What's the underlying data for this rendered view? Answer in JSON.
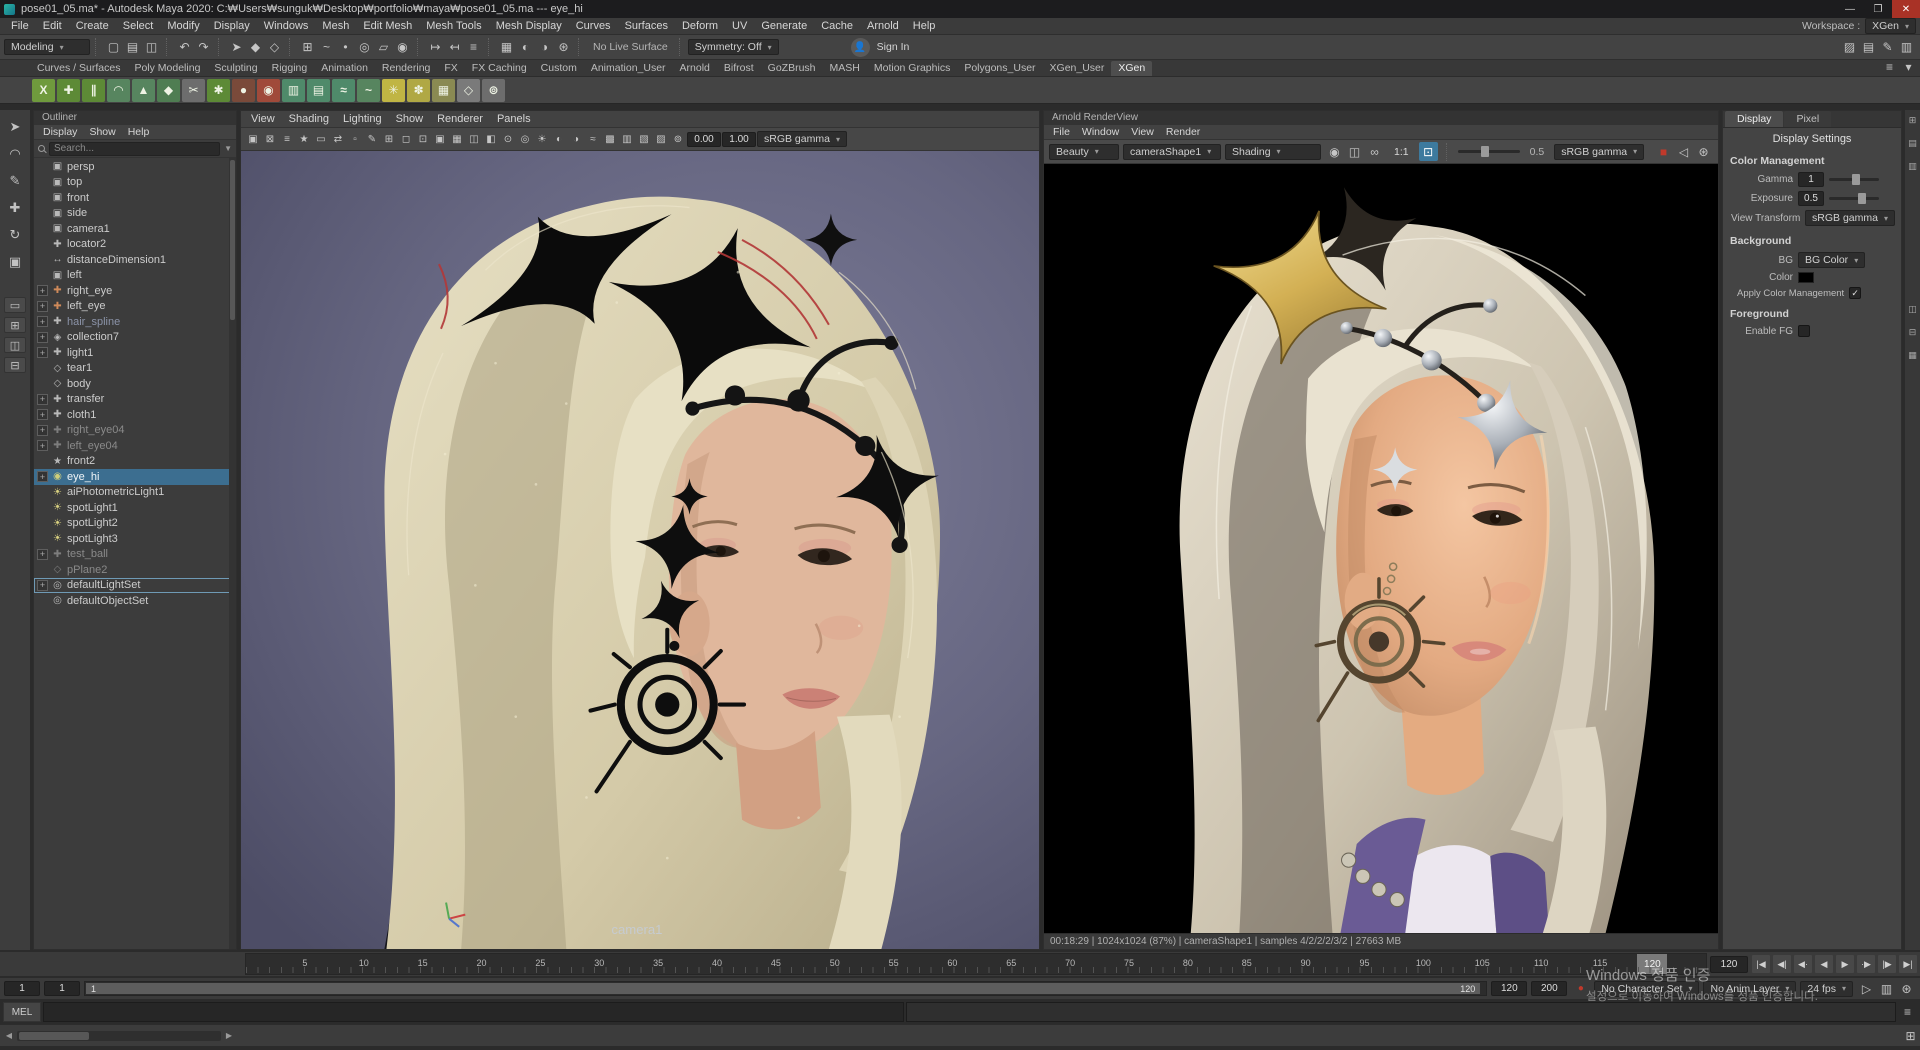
{
  "window": {
    "title": "pose01_05.ma* - Autodesk Maya 2020: C:₩Users₩sunguk₩Desktop₩portfolio₩maya₩pose01_05.ma --- eye_hi",
    "minimize": "—",
    "maximize": "❐",
    "close": "✕"
  },
  "menubar": {
    "items": [
      "File",
      "Edit",
      "Create",
      "Select",
      "Modify",
      "Display",
      "Windows",
      "Mesh",
      "Edit Mesh",
      "Mesh Tools",
      "Mesh Display",
      "Curves",
      "Surfaces",
      "Deform",
      "UV",
      "Generate",
      "Cache",
      "Arnold",
      "Help"
    ],
    "workspace_label": "Workspace :",
    "workspace_value": "XGen"
  },
  "statusline": {
    "mode": "Modeling",
    "no_live_surface": "No Live Surface",
    "symmetry": "Symmetry: Off",
    "sign_in": "Sign In",
    "file_icons": [
      {
        "name": "new-scene-icon",
        "glyph": "▢"
      },
      {
        "name": "open-scene-icon",
        "glyph": "▤"
      },
      {
        "name": "save-scene-icon",
        "glyph": "◫"
      }
    ],
    "undo_icons": [
      {
        "name": "undo-icon",
        "glyph": "↶"
      },
      {
        "name": "redo-icon",
        "glyph": "↷"
      }
    ],
    "select_icons": [
      {
        "name": "select-by-hierarchy-icon",
        "glyph": "➤"
      },
      {
        "name": "select-by-object-icon",
        "glyph": "◆"
      },
      {
        "name": "select-by-component-icon",
        "glyph": "◇"
      }
    ],
    "snap_icons": [
      {
        "name": "snap-to-grid-icon",
        "glyph": "⊞"
      },
      {
        "name": "snap-to-curve-icon",
        "glyph": "~"
      },
      {
        "name": "snap-to-point-icon",
        "glyph": "•"
      },
      {
        "name": "snap-to-projected-center-icon",
        "glyph": "◎"
      },
      {
        "name": "snap-to-view-plane-icon",
        "glyph": "▱"
      },
      {
        "name": "make-live-icon",
        "glyph": "◉"
      }
    ],
    "history_icons": [
      {
        "name": "input-connections-icon",
        "glyph": "↦"
      },
      {
        "name": "output-connections-icon",
        "glyph": "↤"
      },
      {
        "name": "construction-history-icon",
        "glyph": "≡"
      }
    ],
    "render_icons": [
      {
        "name": "render-view-icon",
        "glyph": "▦"
      },
      {
        "name": "current-frame-render-icon",
        "glyph": "◐"
      },
      {
        "name": "ipr-render-icon",
        "glyph": "◑"
      },
      {
        "name": "render-settings-icon",
        "glyph": "⊛"
      }
    ],
    "right_icons": [
      {
        "name": "modeling-toolkit-icon",
        "glyph": "▨"
      },
      {
        "name": "attribute-editor-icon",
        "glyph": "▤"
      },
      {
        "name": "tool-settings-icon",
        "glyph": "✎"
      },
      {
        "name": "channel-box-icon",
        "glyph": "▥"
      }
    ]
  },
  "shelf": {
    "tabs": [
      "Curves / Surfaces",
      "Poly Modeling",
      "Sculpting",
      "Rigging",
      "Animation",
      "Rendering",
      "FX",
      "FX Caching",
      "Custom",
      "Animation_User",
      "Arnold",
      "Bifrost",
      "GoZBrush",
      "MASH",
      "Motion Graphics",
      "Polygons_User",
      "XGen_User",
      "XGen"
    ],
    "active_tab": "XGen",
    "menu_icons": [
      {
        "name": "shelf-menu-icon",
        "glyph": "≡"
      },
      {
        "name": "shelf-options-icon",
        "glyph": "▾"
      }
    ],
    "icons": [
      {
        "name": "xgen-create-description-icon",
        "glyph": "X",
        "bg": "#6f9a3d"
      },
      {
        "name": "xgen-add-guide-icon",
        "glyph": "✚",
        "bg": "#5d8a36"
      },
      {
        "name": "xgen-guides-icon",
        "glyph": "∥",
        "bg": "#5d8a36"
      },
      {
        "name": "xgen-comb-icon",
        "glyph": "◠",
        "bg": "#57855f"
      },
      {
        "name": "xgen-density-icon",
        "glyph": "▲",
        "bg": "#57855f"
      },
      {
        "name": "xgen-clump-icon",
        "glyph": "◆",
        "bg": "#4f7d52"
      },
      {
        "name": "xgen-cut-icon",
        "glyph": "✂",
        "bg": "#6d6d6d"
      },
      {
        "name": "xgen-noise-icon",
        "glyph": "✱",
        "bg": "#5d8a36"
      },
      {
        "name": "xgen-sphere-icon",
        "glyph": "●",
        "bg": "#7a4a3a"
      },
      {
        "name": "xgen-bake-icon",
        "glyph": "◉",
        "bg": "#a04a3a"
      },
      {
        "name": "xgen-patch-icon",
        "glyph": "▥",
        "bg": "#4f8a6a"
      },
      {
        "name": "xgen-collection-icon",
        "glyph": "▤",
        "bg": "#4f8a6a"
      },
      {
        "name": "xgen-modifier-icon",
        "glyph": "≈",
        "bg": "#4f8a6a"
      },
      {
        "name": "xgen-curve-icon",
        "glyph": "~",
        "bg": "#57855f"
      },
      {
        "name": "xgen-preview-icon",
        "glyph": "✳",
        "bg": "#c0b544"
      },
      {
        "name": "xgen-export-icon",
        "glyph": "✽",
        "bg": "#b0a844"
      },
      {
        "name": "xgen-grid-icon",
        "glyph": "▦",
        "bg": "#8a8a52"
      },
      {
        "name": "xgen-freeze-icon",
        "glyph": "◇",
        "bg": "#7a7a7a"
      },
      {
        "name": "xgen-util-icon",
        "glyph": "⊚",
        "bg": "#6d6d6d"
      }
    ]
  },
  "toolbox": {
    "tools": [
      {
        "name": "select-tool-icon",
        "glyph": "➤"
      },
      {
        "name": "lasso-tool-icon",
        "glyph": "◠"
      },
      {
        "name": "paint-select-tool-icon",
        "glyph": "✎"
      },
      {
        "name": "move-tool-icon",
        "glyph": "✚"
      },
      {
        "name": "rotate-tool-icon",
        "glyph": "↻"
      },
      {
        "name": "scale-tool-icon",
        "glyph": "▣"
      }
    ],
    "layouts": [
      {
        "name": "single-pane-layout-icon",
        "glyph": "▭"
      },
      {
        "name": "four-pane-layout-icon",
        "glyph": "⊞"
      },
      {
        "name": "persp-outliner-layout-icon",
        "glyph": "◫"
      },
      {
        "name": "custom-layout-icon",
        "glyph": "⊟"
      }
    ]
  },
  "outliner": {
    "title": "Outliner",
    "menus": [
      "Display",
      "Show",
      "Help"
    ],
    "search_placeholder": "Search...",
    "items": [
      {
        "label": "persp",
        "icon": "camera-icon",
        "glyph": "▣",
        "expand": false,
        "state": "normal"
      },
      {
        "label": "top",
        "icon": "camera-icon",
        "glyph": "▣",
        "expand": false,
        "state": "normal"
      },
      {
        "label": "front",
        "icon": "camera-icon",
        "glyph": "▣",
        "expand": false,
        "state": "normal"
      },
      {
        "label": "side",
        "icon": "camera-icon",
        "glyph": "▣",
        "expand": false,
        "state": "normal"
      },
      {
        "label": "camera1",
        "icon": "camera-icon",
        "glyph": "▣",
        "expand": false,
        "state": "normal"
      },
      {
        "label": "locator2",
        "icon": "locator-icon",
        "glyph": "✚",
        "expand": false,
        "state": "normal"
      },
      {
        "label": "distanceDimension1",
        "icon": "distance-dimension-icon",
        "glyph": "↔",
        "expand": false,
        "state": "normal"
      },
      {
        "label": "left",
        "icon": "camera-icon",
        "glyph": "▣",
        "expand": false,
        "state": "normal"
      },
      {
        "label": "right_eye",
        "icon": "transform-icon",
        "glyph": "✚",
        "color": "#cf8a5a",
        "expand": true,
        "state": "normal"
      },
      {
        "label": "left_eye",
        "icon": "transform-icon",
        "glyph": "✚",
        "color": "#cf8a5a",
        "expand": true,
        "state": "normal"
      },
      {
        "label": "hair_spline",
        "icon": "transform-icon",
        "glyph": "✚",
        "expand": true,
        "state": "ref"
      },
      {
        "label": "collection7",
        "icon": "collection-icon",
        "glyph": "◈",
        "expand": true,
        "state": "normal"
      },
      {
        "label": "light1",
        "icon": "transform-icon",
        "glyph": "✚",
        "expand": true,
        "state": "normal"
      },
      {
        "label": "tear1",
        "icon": "mesh-icon",
        "glyph": "◇",
        "expand": false,
        "state": "normal"
      },
      {
        "label": "body",
        "icon": "mesh-icon",
        "glyph": "◇",
        "expand": false,
        "state": "normal"
      },
      {
        "label": "transfer",
        "icon": "transform-icon",
        "glyph": "✚",
        "expand": true,
        "state": "normal"
      },
      {
        "label": "cloth1",
        "icon": "transform-icon",
        "glyph": "✚",
        "expand": true,
        "state": "normal"
      },
      {
        "label": "right_eye04",
        "icon": "transform-icon",
        "glyph": "✚",
        "expand": true,
        "state": "dim"
      },
      {
        "label": "left_eye04",
        "icon": "transform-icon",
        "glyph": "✚",
        "expand": true,
        "state": "dim"
      },
      {
        "label": "front2",
        "icon": "camera-icon",
        "glyph": "★",
        "expand": false,
        "state": "normal"
      },
      {
        "label": "eye_hi",
        "icon": "textured-sphere-icon",
        "glyph": "◉",
        "color": "#cfcf7a",
        "expand": true,
        "state": "selected"
      },
      {
        "label": "aiPhotometricLight1",
        "icon": "light-icon",
        "glyph": "☀",
        "color": "#d8d080",
        "expand": false,
        "state": "normal"
      },
      {
        "label": "spotLight1",
        "icon": "spotlight-icon",
        "glyph": "☀",
        "color": "#d8d080",
        "expand": false,
        "state": "normal"
      },
      {
        "label": "spotLight2",
        "icon": "spotlight-icon",
        "glyph": "☀",
        "color": "#d8d080",
        "expand": false,
        "state": "normal"
      },
      {
        "label": "spotLight3",
        "icon": "spotlight-icon",
        "glyph": "☀",
        "color": "#d8d080",
        "expand": false,
        "state": "normal"
      },
      {
        "label": "test_ball",
        "icon": "transform-icon",
        "glyph": "✚",
        "expand": true,
        "state": "dim"
      },
      {
        "label": "pPlane2",
        "icon": "mesh-icon",
        "glyph": "◇",
        "expand": false,
        "state": "dim"
      },
      {
        "label": "defaultLightSet",
        "icon": "set-icon",
        "glyph": "◎",
        "expand": true,
        "state": "outlined"
      },
      {
        "label": "defaultObjectSet",
        "icon": "set-icon",
        "glyph": "◎",
        "expand": false,
        "state": "normal"
      }
    ]
  },
  "viewport": {
    "menus": [
      "View",
      "Shading",
      "Lighting",
      "Show",
      "Renderer",
      "Panels"
    ],
    "toolbar": {
      "icons": [
        {
          "name": "select-camera-icon",
          "glyph": "▣"
        },
        {
          "name": "lock-camera-icon",
          "glyph": "⊠"
        },
        {
          "name": "camera-attributes-icon",
          "glyph": "≡"
        },
        {
          "name": "bookmark-icon",
          "glyph": "★"
        },
        {
          "name": "image-plane-icon",
          "glyph": "▭"
        },
        {
          "name": "2d-pan-zoom-icon",
          "glyph": "⇄"
        },
        {
          "name": "oversampling-icon",
          "glyph": "▫"
        },
        {
          "name": "grease-pencil-icon",
          "glyph": "✎"
        },
        {
          "name": "grid-icon",
          "glyph": "⊞"
        },
        {
          "name": "film-gate-icon",
          "glyph": "◻"
        },
        {
          "name": "resolution-gate-icon",
          "glyph": "⊡"
        },
        {
          "name": "gate-mask-icon",
          "glyph": "▣"
        },
        {
          "name": "field-chart-icon",
          "glyph": "▦"
        },
        {
          "name": "safe-action-icon",
          "glyph": "◫"
        },
        {
          "name": "safe-title-icon",
          "glyph": "◧"
        },
        {
          "name": "frame-all-icon",
          "glyph": "⊙"
        },
        {
          "name": "frame-selected-icon",
          "glyph": "◎"
        },
        {
          "name": "lighting-icon",
          "glyph": "☀"
        },
        {
          "name": "shadows-icon",
          "glyph": "◐"
        },
        {
          "name": "ssao-icon",
          "glyph": "◑"
        },
        {
          "name": "motion-blur-icon",
          "glyph": "≈"
        },
        {
          "name": "multisample-icon",
          "glyph": "▩"
        },
        {
          "name": "xray-icon",
          "glyph": "▥"
        },
        {
          "name": "wireframe-on-shaded-icon",
          "glyph": "▧"
        },
        {
          "name": "textured-icon",
          "glyph": "▨"
        },
        {
          "name": "isolate-select-icon",
          "glyph": "⊚"
        }
      ],
      "field1": "0.00",
      "field2": "1.00",
      "gamma": "sRGB gamma"
    },
    "camera_label": "camera1"
  },
  "arnold": {
    "title": "Arnold RenderView",
    "menus": [
      "File",
      "Window",
      "View",
      "Render"
    ],
    "toolbar": {
      "aov": "Beauty",
      "camera": "cameraShape1",
      "shading": "Shading",
      "mid_icons": [
        {
          "name": "snapshot-icon",
          "glyph": "◉"
        },
        {
          "name": "compare-icon",
          "glyph": "◫"
        },
        {
          "name": "sync-camera-icon",
          "glyph": "∞"
        }
      ],
      "zoom": "1:1",
      "exposure_value": "0.5",
      "gamma": "sRGB gamma",
      "right_icons": [
        {
          "name": "stop-render-icon",
          "glyph": "■",
          "color": "#c0392b"
        },
        {
          "name": "mute-icon",
          "glyph": "◁"
        },
        {
          "name": "settings-gear-icon",
          "glyph": "⊛"
        }
      ]
    },
    "status": "00:18:29 | 1024x1024 (87%) | cameraShape1  | samples 4/2/2/2/3/2 | 27663 MB"
  },
  "display_settings": {
    "tabs": [
      "Display",
      "Pixel"
    ],
    "title": "Display Settings",
    "sections": {
      "color_management": {
        "title": "Color Management",
        "gamma_label": "Gamma",
        "gamma_value": "1",
        "exposure_label": "Exposure",
        "exposure_value": "0.5",
        "view_transform_label": "View Transform",
        "view_transform_value": "sRGB gamma"
      },
      "background": {
        "title": "Background",
        "bg_label": "BG",
        "bg_value": "BG Color",
        "color_label": "Color",
        "apply_cm_label": "Apply Color Management",
        "apply_cm_checked": true
      },
      "foreground": {
        "title": "Foreground",
        "enable_fg_label": "Enable FG",
        "enable_fg_checked": false
      }
    }
  },
  "timeline": {
    "ticks": [
      "5",
      "10",
      "15",
      "20",
      "25",
      "30",
      "35",
      "40",
      "45",
      "50",
      "55",
      "60",
      "65",
      "70",
      "75",
      "80",
      "85",
      "90",
      "95",
      "100",
      "105",
      "110",
      "115"
    ],
    "current_frame": "120",
    "current_frame_field": "120"
  },
  "playback": {
    "buttons": [
      {
        "name": "go-to-start-button",
        "glyph": "|◀"
      },
      {
        "name": "step-back-frame-button",
        "glyph": "◀|"
      },
      {
        "name": "step-back-key-button",
        "glyph": "◀·"
      },
      {
        "name": "play-backward-button",
        "glyph": "◀"
      },
      {
        "name": "play-forward-button",
        "glyph": "▶"
      },
      {
        "name": "step-forward-key-button",
        "glyph": "·▶"
      },
      {
        "name": "step-forward-frame-button",
        "glyph": "|▶"
      },
      {
        "name": "go-to-end-button",
        "glyph": "▶|"
      }
    ]
  },
  "range_slider": {
    "anim_start": "1",
    "play_start": "1",
    "bar_start_label": "1",
    "bar_end_label": "120",
    "play_end": "120",
    "anim_end": "200",
    "character_set": "No Character Set",
    "anim_layer": "No Anim Layer",
    "fps": "24 fps",
    "right_icons": [
      {
        "name": "playback-speed-icon",
        "glyph": "▷"
      },
      {
        "name": "cache-icon",
        "glyph": "▥"
      },
      {
        "name": "animation-preferences-icon",
        "glyph": "⊛"
      }
    ]
  },
  "command_line": {
    "label": "MEL"
  },
  "watermark": {
    "line1": "Windows 정품 인증",
    "line2": "설정으로 이동하여 Windows를 정품 인증합니다."
  }
}
